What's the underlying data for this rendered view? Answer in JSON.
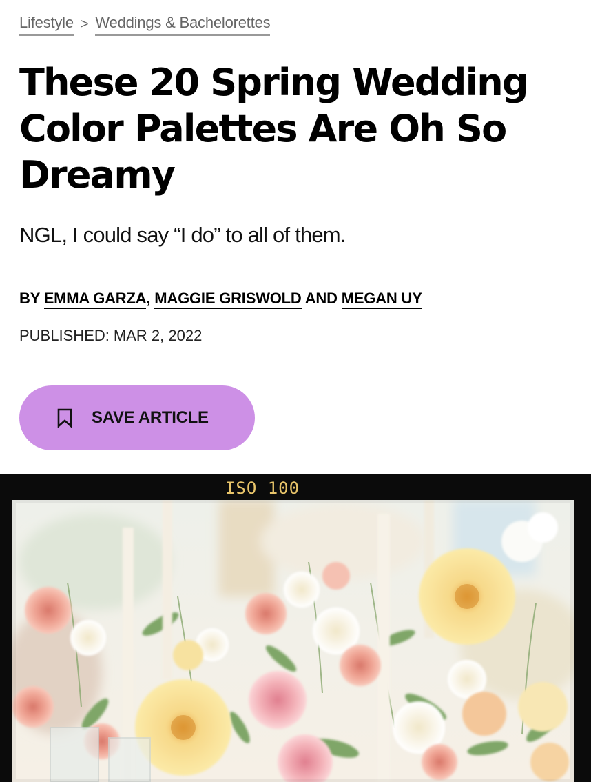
{
  "breadcrumb": {
    "items": [
      "Lifestyle",
      "Weddings & Bachelorettes"
    ],
    "separator": ">"
  },
  "article": {
    "title": "These 20 Spring Wedding Color Palettes Are Oh So Dreamy",
    "dek": "NGL, I could say “I do” to all of them.",
    "byline": {
      "prefix": "BY",
      "authors": [
        "EMMA GARZA",
        "MAGGIE GRISWOLD",
        "MEGAN UY"
      ],
      "comma": ",",
      "and": "AND"
    },
    "published": "PUBLISHED: MAR 2, 2022"
  },
  "save_button": {
    "label": "SAVE ARTICLE",
    "icon": "bookmark-icon",
    "color": "#cd90e6"
  },
  "hero_image": {
    "overlay_text": "ISO 100",
    "overlay_color": "#e8c46a",
    "frame_color": "#0b0b0b"
  }
}
